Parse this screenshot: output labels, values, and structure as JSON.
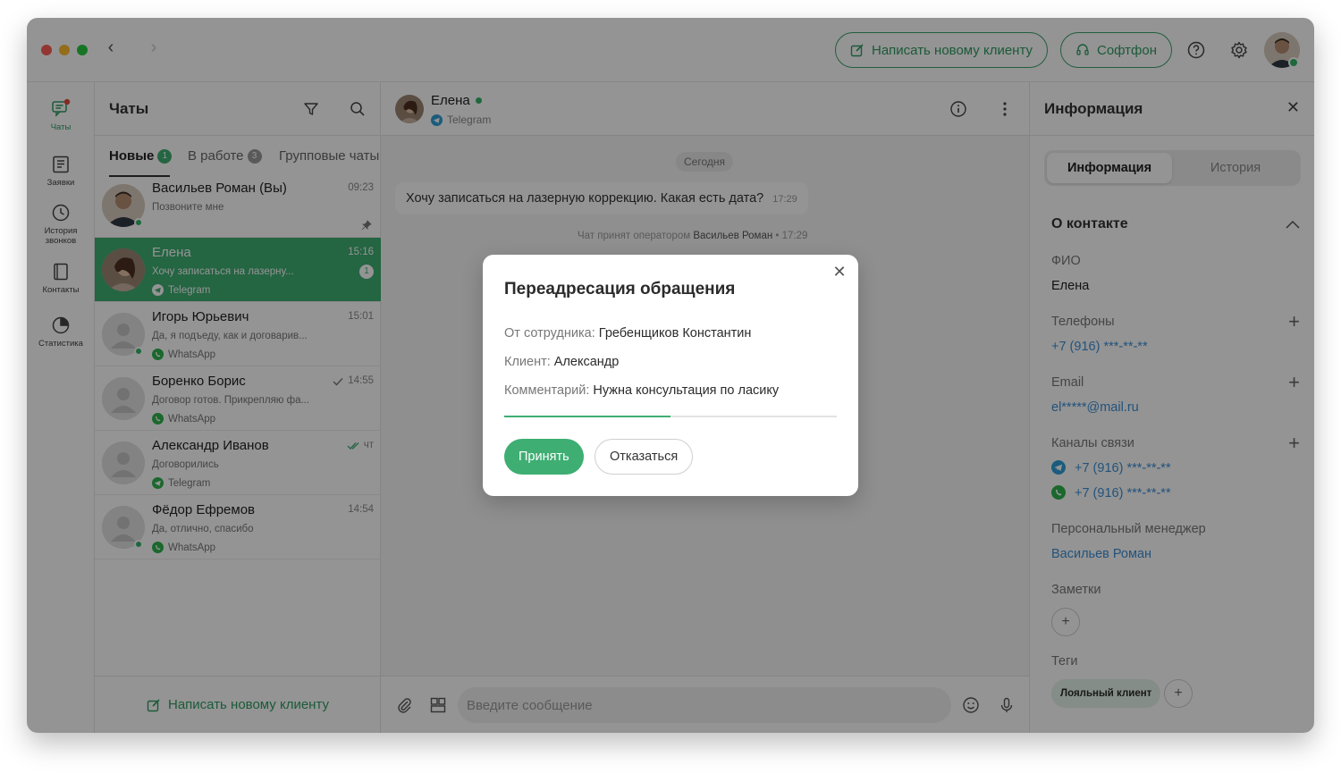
{
  "titlebar": {
    "write_new_client_label": "Написать новому клиенту",
    "softphone_label": "Софтфон"
  },
  "rail": {
    "items": [
      {
        "label": "Чаты",
        "icon": "chat-icon",
        "active": true
      },
      {
        "label": "Заявки",
        "icon": "requests-icon"
      },
      {
        "label": "История звонков",
        "icon": "clock-icon"
      },
      {
        "label": "Контакты",
        "icon": "contacts-icon"
      },
      {
        "label": "Статистика",
        "icon": "pie-chart-icon"
      }
    ]
  },
  "chatlist": {
    "title": "Чаты",
    "tabs": [
      {
        "label": "Новые",
        "badge": "1"
      },
      {
        "label": "В работе",
        "badge": "3"
      },
      {
        "label": "Групповые чаты"
      }
    ],
    "chats": [
      {
        "name": "Васильев Роман (Вы)",
        "time": "09:23",
        "preview": "Позвоните мне",
        "channel": ""
      },
      {
        "name": "Елена",
        "time": "15:16",
        "preview": "Хочу записаться на лазерну...",
        "channel": "Telegram",
        "unread": "1"
      },
      {
        "name": "Игорь Юрьевич",
        "time": "15:01",
        "preview": "Да, я подъеду, как и договарив...",
        "channel": "WhatsApp"
      },
      {
        "name": "Боренко Борис",
        "time": "14:55",
        "preview": "Договор готов. Прикрепляю фа...",
        "channel": "WhatsApp"
      },
      {
        "name": "Александр Иванов",
        "time": "чт",
        "preview": "Договорились",
        "channel": "Telegram"
      },
      {
        "name": "Фёдор Ефремов",
        "time": "14:54",
        "preview": "Да, отлично, спасибо",
        "channel": "WhatsApp"
      }
    ],
    "footer_label": "Написать новому клиенту"
  },
  "conversation": {
    "contact_name": "Елена",
    "contact_channel": "Telegram",
    "date_label": "Сегодня",
    "message_text": "Хочу записаться на лазерную коррекцию. Какая есть дата?",
    "message_time": "17:29",
    "system_note_prefix": "Чат принят оператором",
    "system_note_operator": "Васильев Роман",
    "system_note_time": "17:29",
    "input_placeholder": "Введите сообщение"
  },
  "info": {
    "title": "Информация",
    "tab_info": "Информация",
    "tab_history": "История",
    "section_title": "О контакте",
    "fio_label": "ФИО",
    "fio_value": "Елена",
    "phones_label": "Телефоны",
    "phone_value": "+7 (916) ***-**-**",
    "email_label": "Email",
    "email_value": "el*****@mail.ru",
    "channels_label": "Каналы связи",
    "channel_telegram": "+7 (916) ***-**-**",
    "channel_whatsapp": "+7 (916) ***-**-**",
    "manager_label": "Персональный менеджер",
    "manager_value": "Васильев Роман",
    "notes_label": "Заметки",
    "tags_label": "Теги",
    "tag_value": "Лояльный клиент"
  },
  "modal": {
    "title": "Переадресация обращения",
    "from_label": "От сотрудника:",
    "from_value": "Гребенщиков Константин",
    "client_label": "Клиент:",
    "client_value": "Александр",
    "comment_label": "Комментарий:",
    "comment_value": "Нужна консультация по ласику",
    "progress": 0.5,
    "accept_label": "Принять",
    "decline_label": "Отказаться"
  },
  "colors": {
    "accent": "#3eae73",
    "link": "#3d8fd6",
    "telegram": "#2f9fd8",
    "whatsapp": "#2fb34e"
  }
}
